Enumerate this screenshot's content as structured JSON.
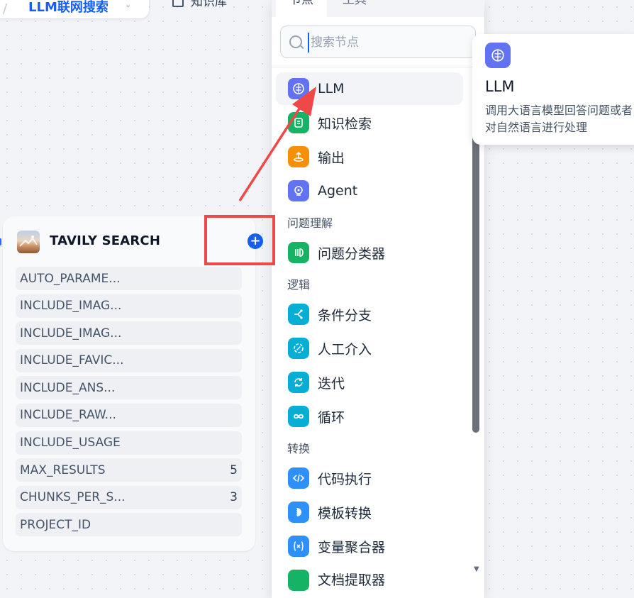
{
  "breadcrumb": {
    "separator": "/",
    "title": "LLM联网搜索",
    "chevron": "⌄"
  },
  "kb_tab": {
    "label": "知识库"
  },
  "node": {
    "title": "TAVILY SEARCH",
    "add_symbol": "+",
    "params": [
      {
        "name": "AUTO_PARAME...",
        "value": ""
      },
      {
        "name": "INCLUDE_IMAG...",
        "value": ""
      },
      {
        "name": "INCLUDE_IMAG...",
        "value": ""
      },
      {
        "name": "INCLUDE_FAVIC...",
        "value": ""
      },
      {
        "name": "INCLUDE_ANS...",
        "value": ""
      },
      {
        "name": "INCLUDE_RAW...",
        "value": ""
      },
      {
        "name": "INCLUDE_USAGE",
        "value": ""
      },
      {
        "name": "MAX_RESULTS",
        "value": "5"
      },
      {
        "name": "CHUNKS_PER_S...",
        "value": "3"
      },
      {
        "name": "PROJECT_ID",
        "value": ""
      }
    ]
  },
  "picker": {
    "tabs": {
      "nodes": "节点",
      "tools": "工具"
    },
    "search_placeholder": "搜索节点",
    "items": [
      {
        "label": "LLM",
        "icon": "brain-icon"
      },
      {
        "label": "知识检索",
        "icon": "knowledge-icon"
      },
      {
        "label": "输出",
        "icon": "output-icon"
      },
      {
        "label": "Agent",
        "icon": "agent-icon"
      },
      {
        "label": "问题分类器",
        "icon": "classifier-icon"
      },
      {
        "label": "条件分支",
        "icon": "branch-icon"
      },
      {
        "label": "人工介入",
        "icon": "human-icon"
      },
      {
        "label": "迭代",
        "icon": "iteration-icon"
      },
      {
        "label": "循环",
        "icon": "loop-icon"
      },
      {
        "label": "代码执行",
        "icon": "code-icon"
      },
      {
        "label": "模板转换",
        "icon": "template-icon"
      },
      {
        "label": "变量聚合器",
        "icon": "variable-icon"
      },
      {
        "label": "文档提取器",
        "icon": "document-icon"
      }
    ],
    "sections": {
      "understanding": "问题理解",
      "logic": "逻辑",
      "transform": "转换"
    }
  },
  "tooltip": {
    "title": "LLM",
    "description": "调用大语言模型回答问题或者对自然语言进行处理"
  },
  "colors": {
    "accent": "#155eef",
    "highlight": "#f04848",
    "indigo": "#6172f3",
    "green": "#16b364",
    "orange": "#f79009",
    "cyan": "#06aed4",
    "blue": "#2e90fa"
  }
}
